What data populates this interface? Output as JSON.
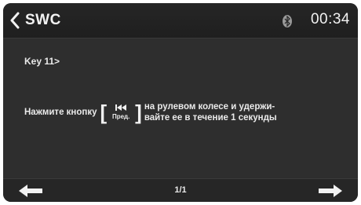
{
  "header": {
    "title": "SWC",
    "time": "00:34",
    "back_icon": "chevron-left-icon",
    "status_icon": "bluetooth-icon"
  },
  "content": {
    "key_label": "Key 11>",
    "instruction_before": "Нажмите кнопку",
    "button_caption": "Пред.",
    "button_icon": "skip-previous-icon",
    "instruction_after_line1": "на рулевом колесе и удержи-",
    "instruction_after_line2": "вайте ее в течение 1 секунды"
  },
  "footer": {
    "page_indicator": "1/1",
    "prev_icon": "arrow-left-icon",
    "next_icon": "arrow-right-icon"
  }
}
